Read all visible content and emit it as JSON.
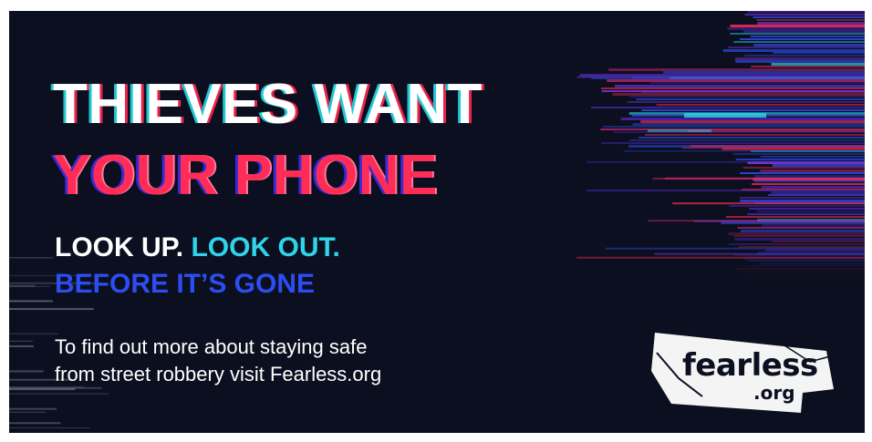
{
  "headline": {
    "line1": "THIEVES WANT",
    "line2": "YOUR PHONE"
  },
  "tagline": {
    "part1": "LOOK UP.",
    "part2": "LOOK OUT.",
    "line2": "BEFORE IT’S GONE"
  },
  "info": {
    "line1": "To find out more about staying safe",
    "line2": "from street robbery visit Fearless.org"
  },
  "logo": {
    "word": "fearless",
    "suffix": ".org"
  },
  "colors": {
    "background": "#0b0f1f",
    "white": "#ffffff",
    "red": "#ff2d55",
    "cyan": "#2fd4ea",
    "blue": "#2d4df2",
    "purple": "#8a3df0"
  }
}
